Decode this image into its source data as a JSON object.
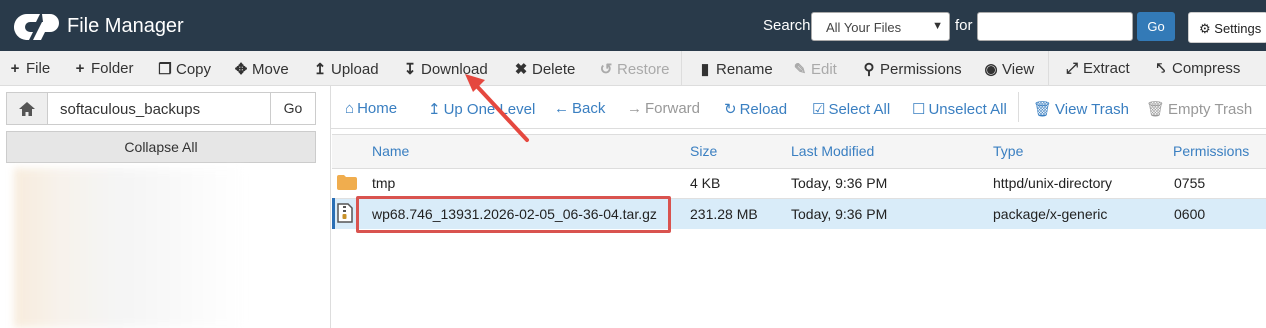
{
  "header": {
    "app_title": "File Manager",
    "logo": "cpanel-logo",
    "search_label": "Search",
    "search_scope": "All Your Files",
    "for_label": "for",
    "search_value": "",
    "go_label": "Go",
    "settings_label": "Settings"
  },
  "toolbar": {
    "file": "File",
    "folder": "Folder",
    "copy": "Copy",
    "move": "Move",
    "upload": "Upload",
    "download": "Download",
    "delete": "Delete",
    "restore": "Restore",
    "rename": "Rename",
    "edit": "Edit",
    "permissions": "Permissions",
    "view": "View",
    "extract": "Extract",
    "compress": "Compress"
  },
  "sidebar": {
    "path_value": "softaculous_backups",
    "go_label": "Go",
    "collapse_label": "Collapse All"
  },
  "nav": {
    "home": "Home",
    "up_one_level": "Up One Level",
    "back": "Back",
    "forward": "Forward",
    "reload": "Reload",
    "select_all": "Select All",
    "unselect_all": "Unselect All",
    "view_trash": "View Trash",
    "empty_trash": "Empty Trash"
  },
  "columns": {
    "name": "Name",
    "size": "Size",
    "modified": "Last Modified",
    "type": "Type",
    "permissions": "Permissions"
  },
  "files": [
    {
      "name": "tmp",
      "size": "4 KB",
      "modified": "Today, 9:36 PM",
      "type": "httpd/unix-directory",
      "perms": "0755",
      "icon": "folder-icon",
      "selected": false
    },
    {
      "name": "wp68.746_13931.2026-02-05_06-36-04.tar.gz",
      "size": "231.28 MB",
      "modified": "Today, 9:36 PM",
      "type": "package/x-generic",
      "perms": "0600",
      "icon": "archive-file-icon",
      "selected": true
    }
  ],
  "colors": {
    "header_bg": "#293a4a",
    "link": "#3a7fc1",
    "selected_row": "#d9ecf9",
    "annotation": "#d9534f",
    "folder": "#f0ad4e"
  }
}
